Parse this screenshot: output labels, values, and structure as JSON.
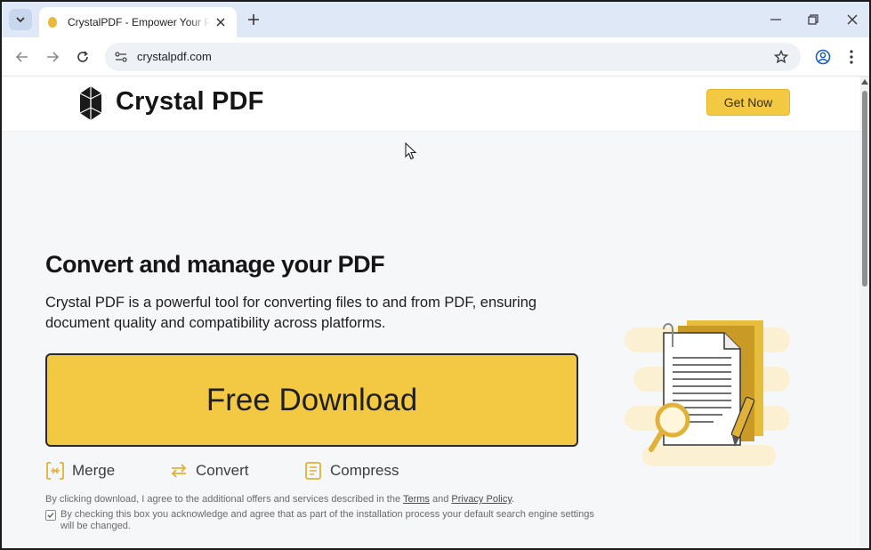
{
  "browser": {
    "tab": {
      "title": "CrystalPDF - Empower Your PDF"
    },
    "address": {
      "url": "crystalpdf.com"
    }
  },
  "site": {
    "brand": "Crystal PDF",
    "header_button": "Get Now",
    "hero": {
      "title": "Convert and manage your PDF",
      "description": "Crystal PDF is a powerful tool for converting files to and from PDF, ensuring document quality and compatibility across platforms.",
      "download_button": "Free Download"
    },
    "features": [
      {
        "label": "Merge",
        "icon": "merge-icon"
      },
      {
        "label": "Convert",
        "icon": "convert-icon"
      },
      {
        "label": "Compress",
        "icon": "compress-icon"
      }
    ],
    "legal": {
      "prefix": "By clicking download, I agree to the additional offers and services described in the ",
      "terms": "Terms",
      "and": " and ",
      "privacy": "Privacy Policy",
      "suffix": ".",
      "checkbox_text": "By checking this box you acknowledge and agree that as part of the installation process your default search engine settings will be changed."
    }
  },
  "colors": {
    "accent": "#f3c842",
    "tabstrip": "#dfe8f6",
    "text": "#161616"
  }
}
